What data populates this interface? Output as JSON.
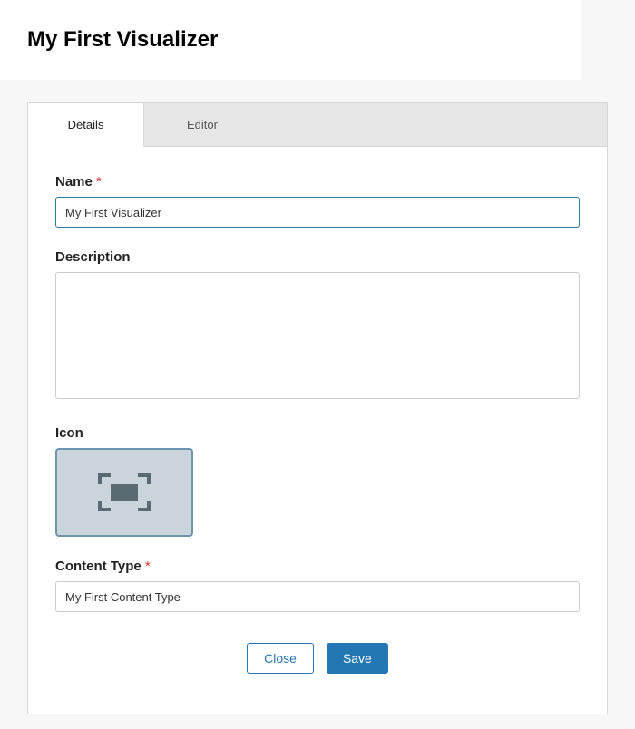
{
  "header": {
    "title": "My First Visualizer"
  },
  "tabs": {
    "details": "Details",
    "editor": "Editor"
  },
  "form": {
    "name_label": "Name",
    "required_marker": "*",
    "name_value": "My First Visualizer",
    "description_label": "Description",
    "description_value": "",
    "icon_label": "Icon",
    "content_type_label": "Content Type",
    "content_type_value": "My First Content Type"
  },
  "buttons": {
    "close": "Close",
    "save": "Save"
  }
}
